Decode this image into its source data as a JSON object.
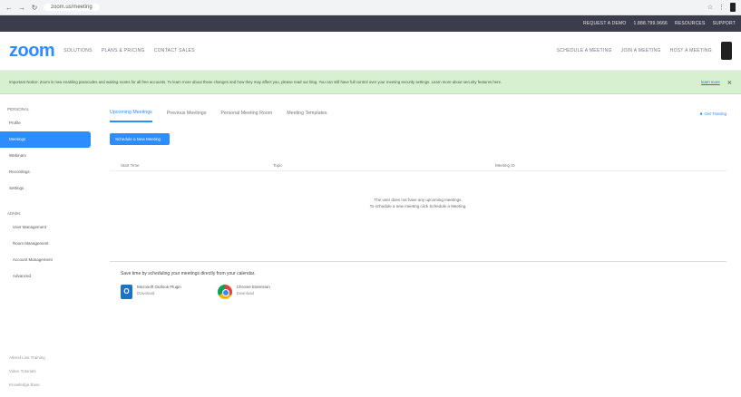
{
  "browser": {
    "back": "←",
    "forward": "→",
    "reload": "↻",
    "url": "zoom.us/meeting",
    "right_icons": [
      "☆",
      "⋮"
    ]
  },
  "topband": {
    "links": [
      "REQUEST A DEMO",
      "1.888.799.9666",
      "RESOURCES",
      "SUPPORT"
    ]
  },
  "header": {
    "logo": "zoom",
    "links": [
      "SOLUTIONS",
      "PLANS & PRICING",
      "CONTACT SALES"
    ],
    "right": [
      "SCHEDULE A MEETING",
      "JOIN A MEETING",
      "HOST A MEETING"
    ]
  },
  "banner": {
    "text": "Important Notice: Zoom is now enabling passcodes and waiting rooms for all free accounts. To learn more about these changes and how they may affect you, please read our blog. You can still have full control over your meeting security settings. Learn more about security features here.",
    "link": "learn more",
    "close": "×"
  },
  "sidebar": {
    "personal_head": "PERSONAL",
    "items": [
      {
        "label": "Profile",
        "active": false
      },
      {
        "label": "Meetings",
        "active": true
      },
      {
        "label": "Webinars",
        "active": false
      },
      {
        "label": "Recordings",
        "active": false
      },
      {
        "label": "Settings",
        "active": false
      }
    ],
    "admin_head": "ADMIN",
    "admin_items": [
      "User Management",
      "Room Management",
      "Account Management",
      "Advanced"
    ],
    "bottom_links": [
      "Attend Live Training",
      "Video Tutorials",
      "Knowledge Base"
    ]
  },
  "main": {
    "tabs": [
      "Upcoming Meetings",
      "Previous Meetings",
      "Personal Meeting Room",
      "Meeting Templates"
    ],
    "right_link": "Get Training",
    "schedule_button": "Schedule a New Meeting",
    "table_headers": [
      "Start Time",
      "Topic",
      "Meeting ID"
    ],
    "empty_line1": "The user does not have any upcoming meetings.",
    "empty_line2": "To schedule a new meeting click Schedule a Meeting.",
    "save_time": "Save time by scheduling your meetings directly from your calendar.",
    "plugins": [
      {
        "name": "Microsoft Outlook Plugin",
        "action": "Download"
      },
      {
        "name": "Chrome Extension",
        "action": "Download"
      }
    ]
  },
  "colors": {
    "accent": "#2d8cff",
    "topband": "#3b3d4d",
    "banner": "#d6f0d0"
  }
}
